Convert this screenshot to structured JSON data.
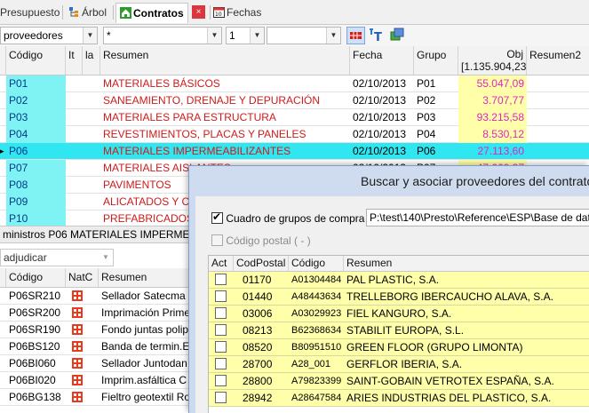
{
  "tabs": [
    {
      "label": "Presupuesto",
      "icon": "presupuesto-icon"
    },
    {
      "label": "Árbol",
      "icon": "tree-icon"
    },
    {
      "label": "Contratos",
      "icon": "home-icon"
    },
    {
      "label": "Fechas",
      "icon": "calendar-icon"
    }
  ],
  "tab_close": "×",
  "filters": {
    "entity": "proveedores",
    "pattern": "*",
    "level": "1",
    "extra": ""
  },
  "main_grid": {
    "headers": {
      "codigo": "Código",
      "it": "It",
      "la": "la",
      "resumen": "Resumen",
      "fecha": "Fecha",
      "grupo": "Grupo",
      "obj_title": "Obj",
      "obj_total": "[1.135.904,23]",
      "resumen2": "Resumen2"
    },
    "rows": [
      {
        "codigo": "P01",
        "resumen": "MATERIALES BÁSICOS",
        "fecha": "02/10/2013",
        "grupo": "P01",
        "obj": "55.047,09"
      },
      {
        "codigo": "P02",
        "resumen": "SANEAMIENTO, DRENAJE Y DEPURACIÓN",
        "fecha": "02/10/2013",
        "grupo": "P02",
        "obj": "3.707,77"
      },
      {
        "codigo": "P03",
        "resumen": "MATERIALES PARA ESTRUCTURA",
        "fecha": "02/10/2013",
        "grupo": "P03",
        "obj": "93.215,58"
      },
      {
        "codigo": "P04",
        "resumen": "REVESTIMIENTOS, PLACAS Y PANELES",
        "fecha": "02/10/2013",
        "grupo": "P04",
        "obj": "8.530,12"
      },
      {
        "codigo": "P06",
        "resumen": "MATERIALES IMPERMEABILIZANTES",
        "fecha": "02/10/2013",
        "grupo": "P06",
        "obj": "27.113,60",
        "selected": true
      },
      {
        "codigo": "P07",
        "resumen": "MATERIALES AISLANTES",
        "fecha": "02/10/2013",
        "grupo": "P07",
        "obj": "47.660,37"
      },
      {
        "codigo": "P08",
        "resumen": "PAVIMENTOS",
        "fecha": "",
        "grupo": "",
        "obj": ""
      },
      {
        "codigo": "P09",
        "resumen": "ALICATADOS Y CH",
        "fecha": "",
        "grupo": "",
        "obj": ""
      },
      {
        "codigo": "P10",
        "resumen": "PREFABRICADOS",
        "fecha": "",
        "grupo": "",
        "obj": ""
      }
    ]
  },
  "status_text": "ministros P06 MATERIALES IMPERMEABILIZANTES",
  "adjudicar_combo": "adjudicar",
  "lower_grid": {
    "headers": {
      "codigo": "Código",
      "natc": "NatC",
      "resumen": "Resumen"
    },
    "rows": [
      {
        "codigo": "P06SR210",
        "resumen": "Sellador Satecma elastómero"
      },
      {
        "codigo": "P06SR200",
        "resumen": "Imprimación Primer"
      },
      {
        "codigo": "P06SR190",
        "resumen": "Fondo juntas polipropileno"
      },
      {
        "codigo": "P06BS120",
        "resumen": "Banda de termin.E"
      },
      {
        "codigo": "P06BI060",
        "resumen": "Sellador Juntodan"
      },
      {
        "codigo": "P06BI020",
        "resumen": "Imprim.asfáltica C"
      },
      {
        "codigo": "P06BG138",
        "resumen": "Fieltro geotextil Ro"
      }
    ]
  },
  "dialog": {
    "title": "Buscar y asociar proveedores del contrato",
    "cuadro_label": "Cuadro de grupos de compra",
    "cuadro_checked": true,
    "path": "P:\\test\\140\\Presto\\Reference\\ESP\\Base de datos de proveedores",
    "codigo_postal_label": "Código postal ( - )",
    "headers": {
      "act": "Act",
      "codpostal": "CodPostal",
      "codigo": "Código",
      "resumen": "Resumen"
    },
    "rows": [
      {
        "cp": "01170",
        "codigo": "A01304484",
        "resumen": "PAL PLASTIC, S.A."
      },
      {
        "cp": "01440",
        "codigo": "A48443634",
        "resumen": "TRELLEBORG IBERCAUCHO ALAVA, S.A."
      },
      {
        "cp": "03006",
        "codigo": "A03029923",
        "resumen": "FIEL KANGURO, S.A."
      },
      {
        "cp": "08213",
        "codigo": "B62368634",
        "resumen": "STABILIT EUROPA, S.L."
      },
      {
        "cp": "08520",
        "codigo": "B80951510",
        "resumen": "GREEN FLOOR (GRUPO LIMONTA)"
      },
      {
        "cp": "28700",
        "codigo": "A28_001",
        "resumen": "GERFLOR IBERIA, S.A."
      },
      {
        "cp": "28800",
        "codigo": "A79823399",
        "resumen": "SAINT-GOBAIN VETROTEX ESPAÑA, S.A."
      },
      {
        "cp": "28942",
        "codigo": "A28647584",
        "resumen": "ARIES INDUSTRIAS DEL PLASTICO, S.A."
      }
    ]
  },
  "colors": {
    "selected_row": "#30e6f0",
    "code_column": "#7ff3f3",
    "obj_column": "#ffffaa",
    "resumen_text": "#cf1a1a",
    "obj_text": "#e026c0",
    "dialog_frame": "#ccd9ee",
    "natc_icon": "#e63b1d"
  }
}
